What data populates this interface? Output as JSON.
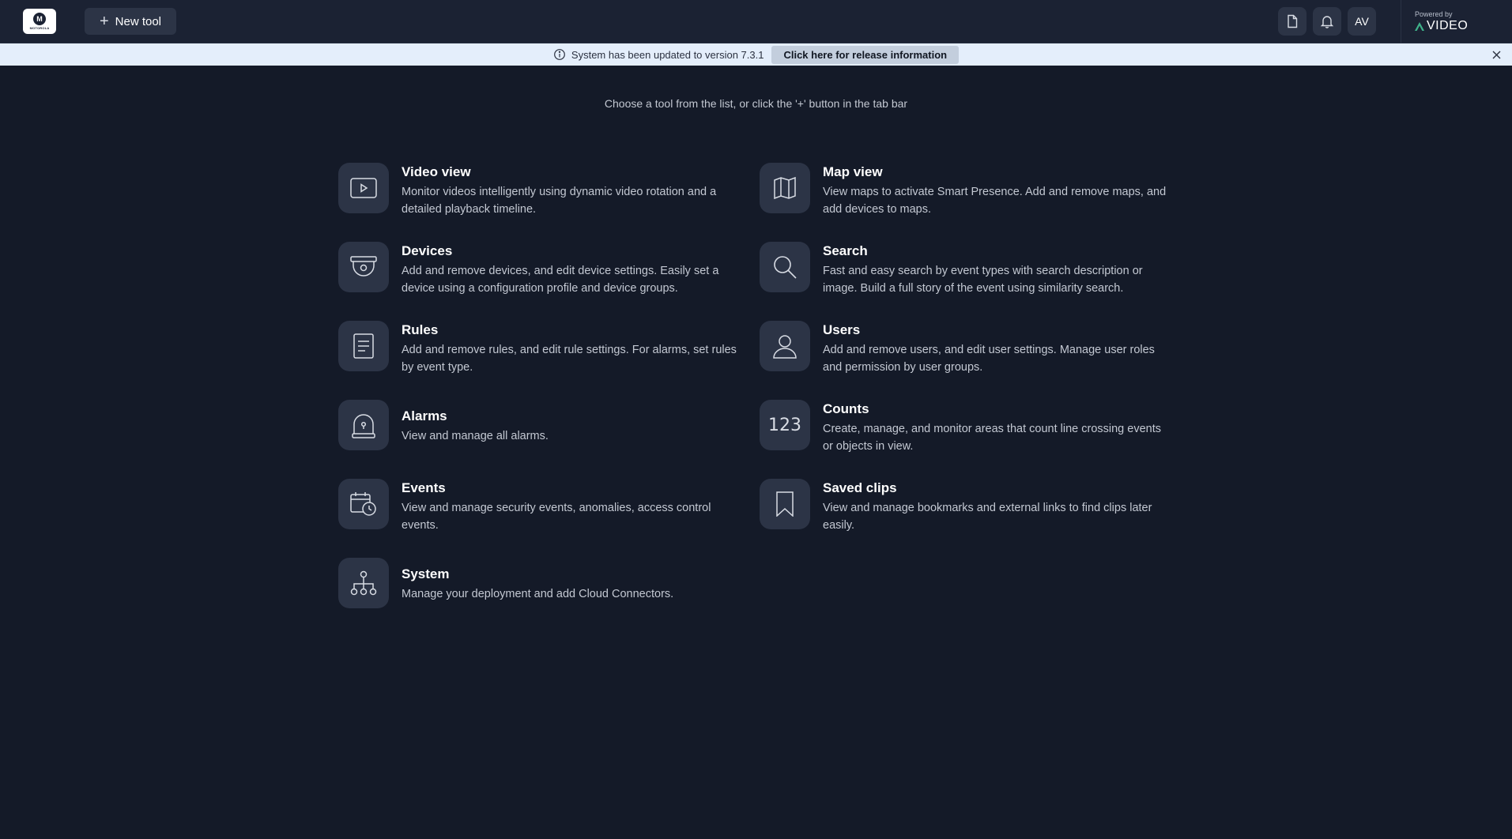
{
  "header": {
    "logo_text": "MOTOROLA",
    "new_tool_label": "New tool",
    "avatar_initials": "AV",
    "powered_by": "Powered by",
    "brand": "VIDEO",
    "icons": [
      "document-icon",
      "bell-icon"
    ]
  },
  "banner": {
    "message": "System has been updated to version 7.3.1",
    "button_label": "Click here for release information"
  },
  "main": {
    "hint": "Choose a tool from the list, or click the '+' button in the tab bar",
    "tools": [
      {
        "title": "Video view",
        "description": "Monitor videos intelligently using dynamic video rotation and a detailed playback timeline.",
        "icon": "video-play-icon"
      },
      {
        "title": "Map view",
        "description": "View maps to activate Smart Presence. Add and remove maps, and add devices to maps.",
        "icon": "map-icon"
      },
      {
        "title": "Devices",
        "description": "Add and remove devices, and edit device settings. Easily set a device using a configuration profile and device groups.",
        "icon": "dome-camera-icon"
      },
      {
        "title": "Search",
        "description": "Fast and easy search by event types with search description or image. Build a full story of the event using similarity search.",
        "icon": "search-icon"
      },
      {
        "title": "Rules",
        "description": "Add and remove rules, and edit rule settings. For alarms, set rules by event type.",
        "icon": "rules-document-icon"
      },
      {
        "title": "Users",
        "description": "Add and remove users, and edit user settings. Manage user roles and permission by user groups.",
        "icon": "user-icon"
      },
      {
        "title": "Alarms",
        "description": "View and manage all alarms.",
        "icon": "alarm-icon"
      },
      {
        "title": "Counts",
        "description": "Create, manage, and monitor areas that count line crossing events or objects in view.",
        "icon": "counts-123-icon",
        "icon_text": "123"
      },
      {
        "title": "Events",
        "description": "View and manage security events, anomalies, access control events.",
        "icon": "calendar-clock-icon"
      },
      {
        "title": "Saved clips",
        "description": "View and manage bookmarks and external links to find clips later easily.",
        "icon": "bookmark-icon"
      },
      {
        "title": "System",
        "description": "Manage your deployment and add Cloud Connectors.",
        "icon": "network-hierarchy-icon"
      }
    ]
  }
}
